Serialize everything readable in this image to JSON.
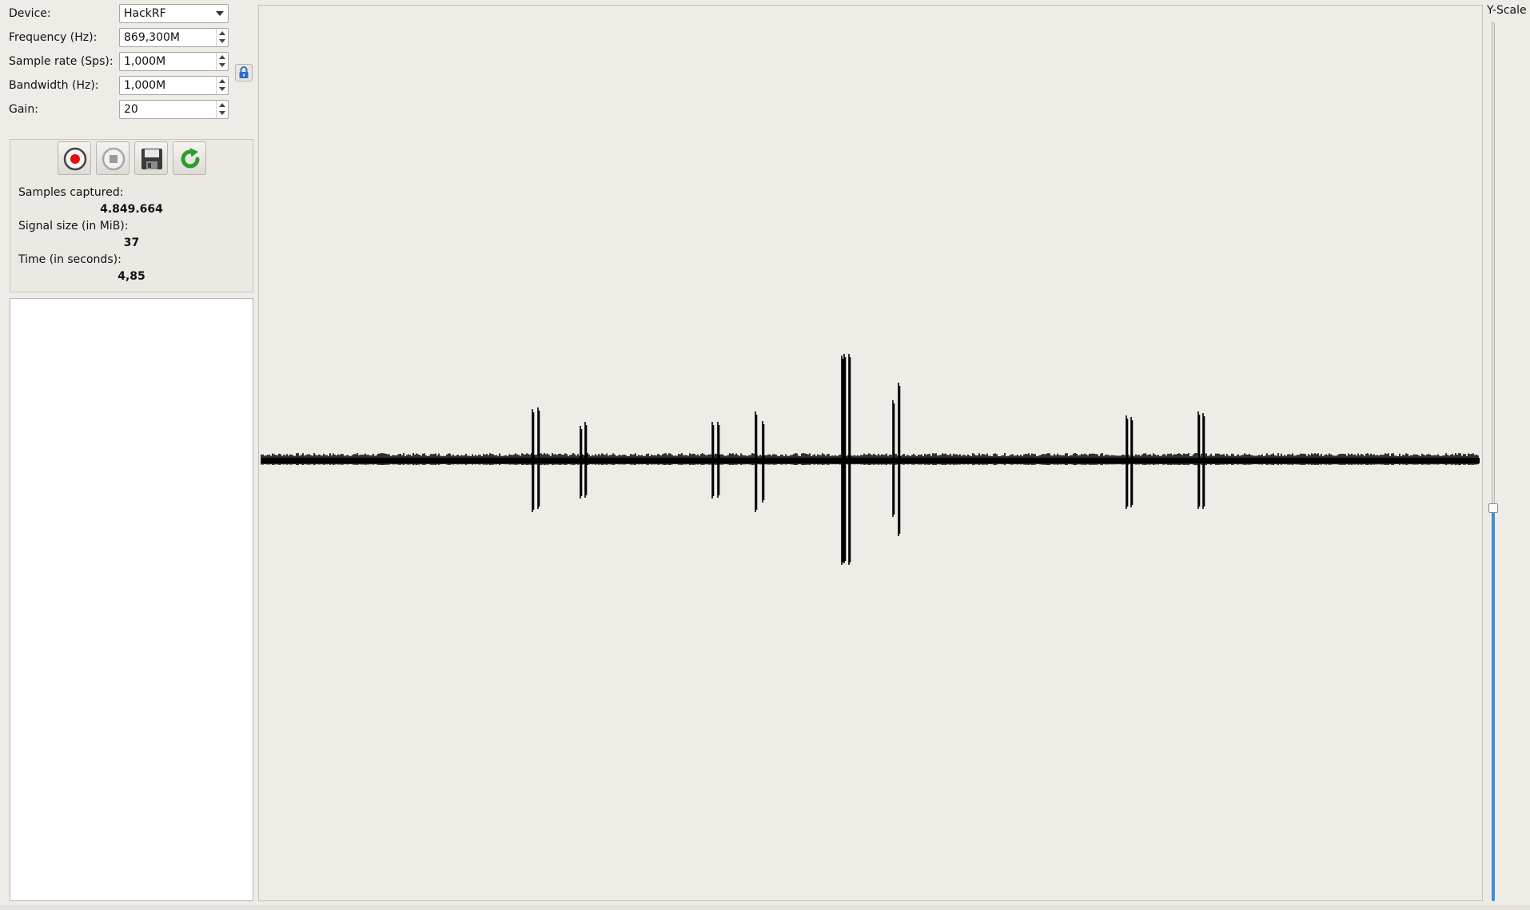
{
  "device": {
    "label": "Device:",
    "value": "HackRF"
  },
  "frequency": {
    "label": "Frequency (Hz):",
    "value": "869,300M"
  },
  "sample_rate": {
    "label": "Sample rate (Sps):",
    "value": "1,000M"
  },
  "bandwidth": {
    "label": "Bandwidth (Hz):",
    "value": "1,000M"
  },
  "gain": {
    "label": "Gain:",
    "value": "20"
  },
  "stats": {
    "samples_label": "Samples captured:",
    "samples_value": "4.849.664",
    "size_label": "Signal size (in MiB):",
    "size_value": "37",
    "time_label": "Time (in seconds):",
    "time_value": "4,85"
  },
  "yscale": {
    "label": "Y-Scale",
    "level": 0.44
  },
  "colors": {
    "accent": "#3a8fd6",
    "record": "#e01010",
    "refresh": "#2e9d2e",
    "lock": "#2a6fd0"
  },
  "icons": [
    "record-icon",
    "stop-icon",
    "save-icon",
    "refresh-icon",
    "lock-icon"
  ]
}
